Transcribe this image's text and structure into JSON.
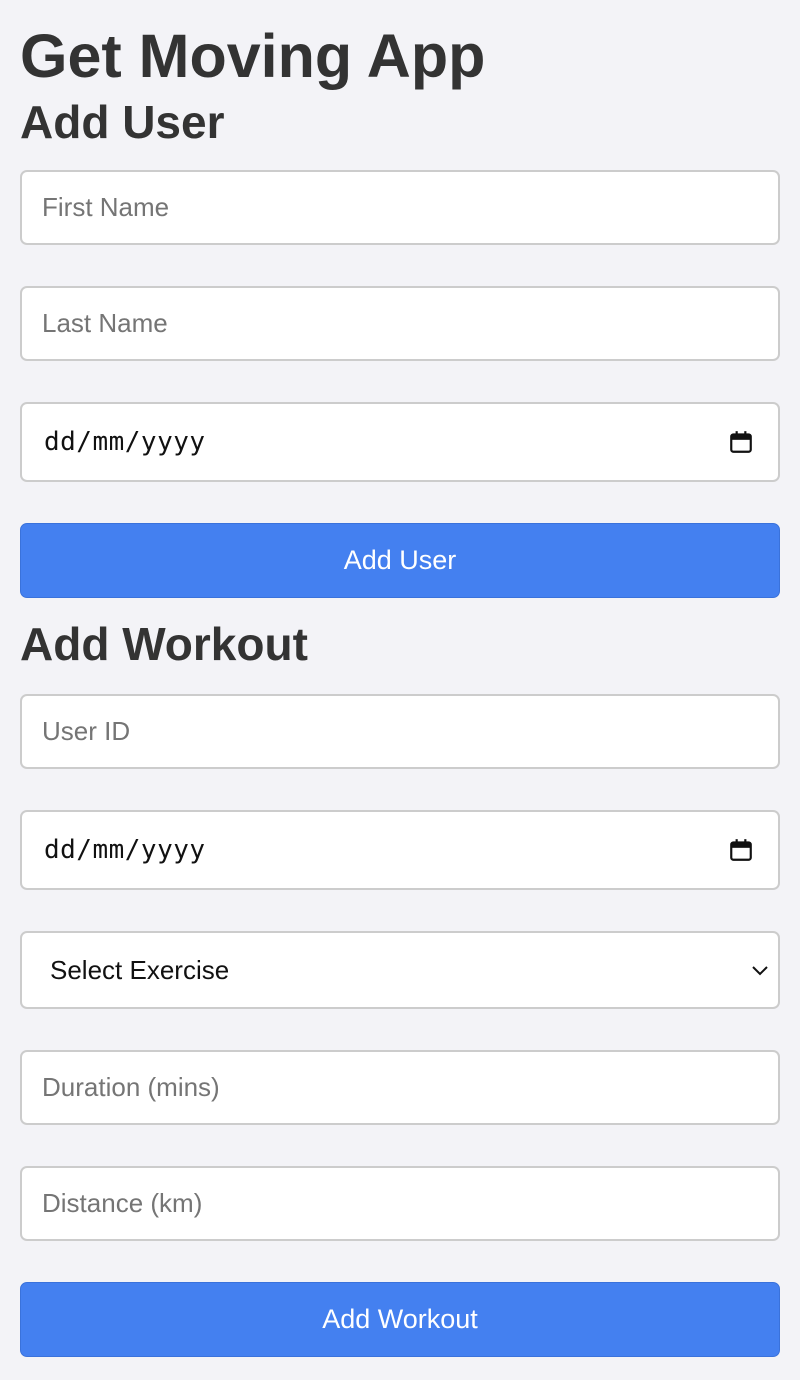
{
  "app": {
    "title": "Get Moving App"
  },
  "add_user": {
    "heading": "Add User",
    "first_name_placeholder": "First Name",
    "last_name_placeholder": "Last Name",
    "date_placeholder": "dd/mm/yyyy",
    "submit_label": "Add User"
  },
  "add_workout": {
    "heading": "Add Workout",
    "user_id_placeholder": "User ID",
    "date_placeholder": "dd/mm/yyyy",
    "exercise_selected": "Select Exercise",
    "duration_placeholder": "Duration (mins)",
    "distance_placeholder": "Distance (km)",
    "submit_label": "Add Workout"
  },
  "icons": {
    "date_picker": "calendar-icon",
    "dropdown": "chevron-down-icon"
  },
  "colors": {
    "background": "#f3f3f7",
    "accent": "#4480f0",
    "heading_text": "#333333",
    "placeholder_text": "#757575",
    "field_border": "#cccccc"
  }
}
